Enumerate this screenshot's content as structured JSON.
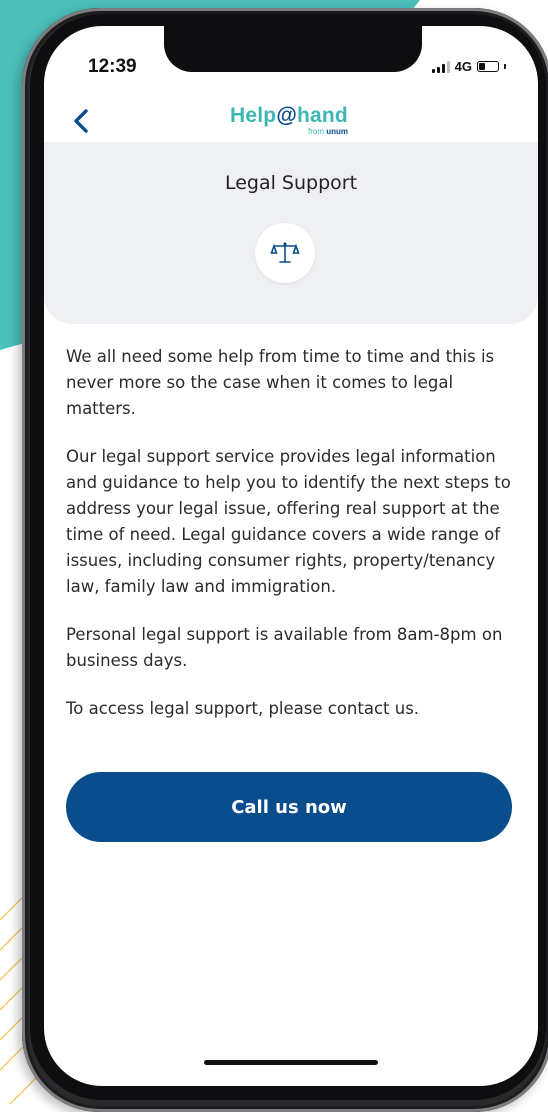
{
  "status_bar": {
    "time": "12:39",
    "network": "4G"
  },
  "app": {
    "logo_text": "Help",
    "logo_at": "@",
    "logo_hand": "hand",
    "logo_sub_from": "from ",
    "logo_sub_brand": "unum"
  },
  "page": {
    "title": "Legal Support",
    "paragraphs": [
      "We all need some help from time to time and this is never more so the case when it comes to legal matters.",
      "Our legal support service provides legal information and guidance to help you to identify the next steps to address your legal issue, offering real support at the time of need. Legal guidance covers a wide range of issues, including consumer rights, property/tenancy law, family law and immigration.",
      "Personal legal support is available from 8am-8pm on business days.",
      "To access legal support, please contact us."
    ],
    "cta_label": "Call us now"
  },
  "colors": {
    "brand_blue": "#0a4d8c",
    "brand_teal": "#3cb7b4",
    "header_bg": "#eef0f3"
  },
  "icons": {
    "back": "chevron-left-icon",
    "service": "scales-icon"
  }
}
